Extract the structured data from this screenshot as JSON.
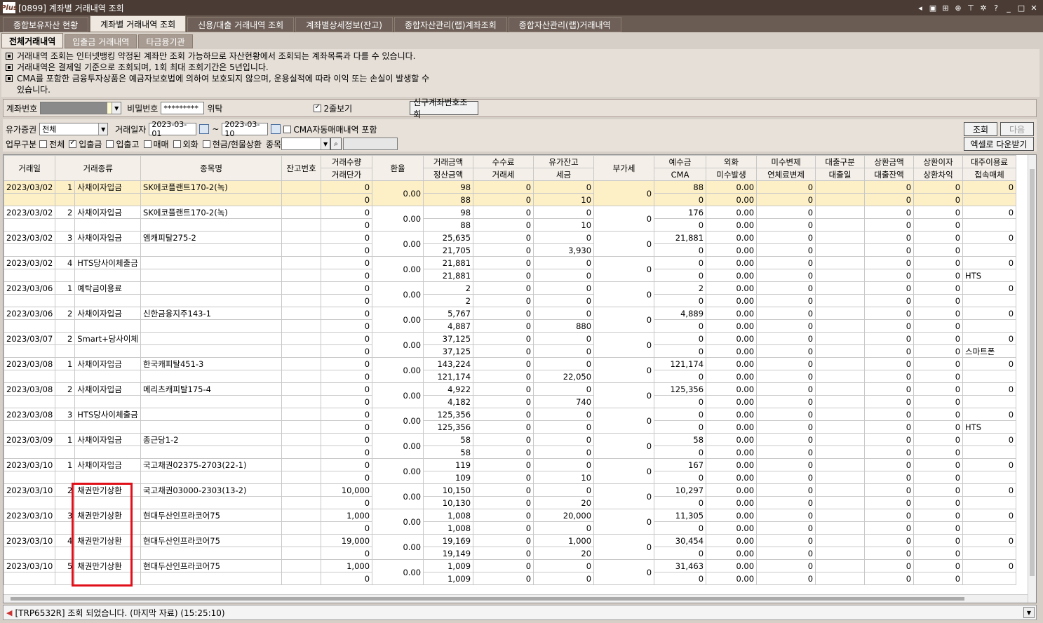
{
  "window": {
    "title": "[0899] 계좌별 거래내역 조회",
    "logo": "Plus"
  },
  "main_tabs": [
    "종합보유자산 현황",
    "계좌별 거래내역 조회",
    "신용/대출 거래내역 조회",
    "계좌별상세정보(잔고)",
    "종합자산관리(랩)계좌조회",
    "종합자산관리(랩)거래내역"
  ],
  "sub_tabs": [
    "전체거래내역",
    "입출금 거래내역",
    "타금융기관"
  ],
  "notices": [
    "거래내역 조회는 인터넷뱅킹 약정된 계좌만 조회 가능하므로 자산현황에서 조회되는 계좌목록과 다를 수 있습니다.",
    "거래내역은 결제일 기준으로 조회되며, 1회 최대 조회기간은 5년입니다.",
    "CMA를 포함한 금융투자상품은 예금자보호법에 의하여 보호되지 않으며, 운용실적에 따라 이익 또는 손실이 발생할 수",
    "있습니다."
  ],
  "account": {
    "account_label": "계좌번호",
    "password_label": "비밀번호",
    "password_value": "*********",
    "trust_label": "위탁",
    "two_line_label": "2줄보기",
    "new_account_button": "신구계좌번호조회"
  },
  "filter": {
    "securities_label": "유가증권",
    "securities_value": "전체",
    "date_label": "거래일자",
    "date_from": "2023-03-01",
    "date_sep": "~",
    "date_to": "2023-03-10",
    "cma_label": "CMA자동매매내역 포함",
    "business_label": "업무구분",
    "opts": [
      "전체",
      "입출금",
      "입출고",
      "매매",
      "외화",
      "현금/현물상환"
    ],
    "item_label": "종목",
    "search_button": "조회",
    "next_button": "다음",
    "excel_button": "엑셀로 다운받기"
  },
  "columns_top": [
    "거래일",
    "거래종류",
    "종목명",
    "잔고번호",
    "거래수량",
    "환율",
    "거래금액",
    "수수료",
    "유가잔고",
    "부가세",
    "예수금",
    "외화",
    "미수변제",
    "대출구분",
    "상환금액",
    "상환이자",
    "대주이용료"
  ],
  "columns_bottom": [
    "거래단가",
    "정산금액",
    "거래세",
    "세금",
    "CMA",
    "미수발생",
    "연체료변제",
    "대출일",
    "대출잔액",
    "상환차익",
    "접속매체"
  ],
  "rows": [
    {
      "date": "2023/03/02",
      "no": "1",
      "type": "사채이자입금",
      "name": "SK에코플랜트170-2(녹)",
      "qty": "0",
      "price": "0",
      "rate": "0.00",
      "amt": "98",
      "settle": "88",
      "fee": "0",
      "tax": "0",
      "bal": "0",
      "bal_tax": "10",
      "vat": "0",
      "dep": "88",
      "cma": "0",
      "fx": "0.00",
      "fx2": "0.00",
      "mis": "0",
      "mis2": "0",
      "rep": "0",
      "rep2": "0",
      "int": "0",
      "int2": "0",
      "use": "0",
      "media": "",
      "sel": true
    },
    {
      "date": "2023/03/02",
      "no": "2",
      "type": "사채이자입금",
      "name": "SK에코플랜트170-2(녹)",
      "qty": "0",
      "price": "0",
      "rate": "0.00",
      "amt": "98",
      "settle": "88",
      "fee": "0",
      "tax": "0",
      "bal": "0",
      "bal_tax": "10",
      "vat": "0",
      "dep": "176",
      "cma": "0",
      "fx": "0.00",
      "fx2": "0.00",
      "mis": "0",
      "mis2": "0",
      "rep": "0",
      "rep2": "0",
      "int": "0",
      "int2": "0",
      "use": "0",
      "media": ""
    },
    {
      "date": "2023/03/02",
      "no": "3",
      "type": "사채이자입금",
      "name": "엠캐피탈275-2",
      "qty": "0",
      "price": "0",
      "rate": "0.00",
      "amt": "25,635",
      "settle": "21,705",
      "fee": "0",
      "tax": "0",
      "bal": "0",
      "bal_tax": "3,930",
      "vat": "0",
      "dep": "21,881",
      "cma": "0",
      "fx": "0.00",
      "fx2": "0.00",
      "mis": "0",
      "mis2": "0",
      "rep": "0",
      "rep2": "0",
      "int": "0",
      "int2": "0",
      "use": "0",
      "media": ""
    },
    {
      "date": "2023/03/02",
      "no": "4",
      "type": "HTS당사이체출금",
      "name": "",
      "qty": "0",
      "price": "0",
      "rate": "0.00",
      "amt": "21,881",
      "settle": "21,881",
      "fee": "0",
      "tax": "0",
      "bal": "0",
      "bal_tax": "0",
      "vat": "0",
      "dep": "0",
      "cma": "0",
      "fx": "0.00",
      "fx2": "0.00",
      "mis": "0",
      "mis2": "0",
      "rep": "0",
      "rep2": "0",
      "int": "0",
      "int2": "0",
      "use": "0",
      "media": "HTS"
    },
    {
      "date": "2023/03/06",
      "no": "1",
      "type": "예탁금이용료",
      "name": "",
      "qty": "0",
      "price": "0",
      "rate": "0.00",
      "amt": "2",
      "settle": "2",
      "fee": "0",
      "tax": "0",
      "bal": "0",
      "bal_tax": "0",
      "vat": "0",
      "dep": "2",
      "cma": "0",
      "fx": "0.00",
      "fx2": "0.00",
      "mis": "0",
      "mis2": "0",
      "rep": "0",
      "rep2": "0",
      "int": "0",
      "int2": "0",
      "use": "0",
      "media": ""
    },
    {
      "date": "2023/03/06",
      "no": "2",
      "type": "사채이자입금",
      "name": "신한금융지주143-1",
      "qty": "0",
      "price": "0",
      "rate": "0.00",
      "amt": "5,767",
      "settle": "4,887",
      "fee": "0",
      "tax": "0",
      "bal": "0",
      "bal_tax": "880",
      "vat": "0",
      "dep": "4,889",
      "cma": "0",
      "fx": "0.00",
      "fx2": "0.00",
      "mis": "0",
      "mis2": "0",
      "rep": "0",
      "rep2": "0",
      "int": "0",
      "int2": "0",
      "use": "0",
      "media": ""
    },
    {
      "date": "2023/03/07",
      "no": "2",
      "type": "Smart+당사이체",
      "name": "",
      "qty": "0",
      "price": "0",
      "rate": "0.00",
      "amt": "37,125",
      "settle": "37,125",
      "fee": "0",
      "tax": "0",
      "bal": "0",
      "bal_tax": "0",
      "vat": "0",
      "dep": "0",
      "cma": "0",
      "fx": "0.00",
      "fx2": "0.00",
      "mis": "0",
      "mis2": "0",
      "rep": "0",
      "rep2": "0",
      "int": "0",
      "int2": "0",
      "use": "0",
      "media": "스마트폰"
    },
    {
      "date": "2023/03/08",
      "no": "1",
      "type": "사채이자입금",
      "name": "한국캐피탈451-3",
      "qty": "0",
      "price": "0",
      "rate": "0.00",
      "amt": "143,224",
      "settle": "121,174",
      "fee": "0",
      "tax": "0",
      "bal": "0",
      "bal_tax": "22,050",
      "vat": "0",
      "dep": "121,174",
      "cma": "0",
      "fx": "0.00",
      "fx2": "0.00",
      "mis": "0",
      "mis2": "0",
      "rep": "0",
      "rep2": "0",
      "int": "0",
      "int2": "0",
      "use": "0",
      "media": ""
    },
    {
      "date": "2023/03/08",
      "no": "2",
      "type": "사채이자입금",
      "name": "메리츠캐피탈175-4",
      "qty": "0",
      "price": "0",
      "rate": "0.00",
      "amt": "4,922",
      "settle": "4,182",
      "fee": "0",
      "tax": "0",
      "bal": "0",
      "bal_tax": "740",
      "vat": "0",
      "dep": "125,356",
      "cma": "0",
      "fx": "0.00",
      "fx2": "0.00",
      "mis": "0",
      "mis2": "0",
      "rep": "0",
      "rep2": "0",
      "int": "0",
      "int2": "0",
      "use": "0",
      "media": ""
    },
    {
      "date": "2023/03/08",
      "no": "3",
      "type": "HTS당사이체출금",
      "name": "",
      "qty": "0",
      "price": "0",
      "rate": "0.00",
      "amt": "125,356",
      "settle": "125,356",
      "fee": "0",
      "tax": "0",
      "bal": "0",
      "bal_tax": "0",
      "vat": "0",
      "dep": "0",
      "cma": "0",
      "fx": "0.00",
      "fx2": "0.00",
      "mis": "0",
      "mis2": "0",
      "rep": "0",
      "rep2": "0",
      "int": "0",
      "int2": "0",
      "use": "0",
      "media": "HTS"
    },
    {
      "date": "2023/03/09",
      "no": "1",
      "type": "사채이자입금",
      "name": "종근당1-2",
      "qty": "0",
      "price": "0",
      "rate": "0.00",
      "amt": "58",
      "settle": "58",
      "fee": "0",
      "tax": "0",
      "bal": "0",
      "bal_tax": "0",
      "vat": "0",
      "dep": "58",
      "cma": "0",
      "fx": "0.00",
      "fx2": "0.00",
      "mis": "0",
      "mis2": "0",
      "rep": "0",
      "rep2": "0",
      "int": "0",
      "int2": "0",
      "use": "0",
      "media": ""
    },
    {
      "date": "2023/03/10",
      "no": "1",
      "type": "사채이자입금",
      "name": "국고채권02375-2703(22-1)",
      "qty": "0",
      "price": "0",
      "rate": "0.00",
      "amt": "119",
      "settle": "109",
      "fee": "0",
      "tax": "0",
      "bal": "0",
      "bal_tax": "10",
      "vat": "0",
      "dep": "167",
      "cma": "0",
      "fx": "0.00",
      "fx2": "0.00",
      "mis": "0",
      "mis2": "0",
      "rep": "0",
      "rep2": "0",
      "int": "0",
      "int2": "0",
      "use": "0",
      "media": ""
    },
    {
      "date": "2023/03/10",
      "no": "2",
      "type": "채권만기상환",
      "name": "국고채권03000-2303(13-2)",
      "qty": "10,000",
      "price": "0",
      "rate": "0.00",
      "amt": "10,150",
      "settle": "10,130",
      "fee": "0",
      "tax": "0",
      "bal": "0",
      "bal_tax": "20",
      "vat": "0",
      "dep": "10,297",
      "cma": "0",
      "fx": "0.00",
      "fx2": "0.00",
      "mis": "0",
      "mis2": "0",
      "rep": "0",
      "rep2": "0",
      "int": "0",
      "int2": "0",
      "use": "0",
      "media": ""
    },
    {
      "date": "2023/03/10",
      "no": "3",
      "type": "채권만기상환",
      "name": "현대두산인프라코어75",
      "qty": "1,000",
      "price": "0",
      "rate": "0.00",
      "amt": "1,008",
      "settle": "1,008",
      "fee": "0",
      "tax": "0",
      "bal": "20,000",
      "bal_tax": "0",
      "vat": "0",
      "dep": "11,305",
      "cma": "0",
      "fx": "0.00",
      "fx2": "0.00",
      "mis": "0",
      "mis2": "0",
      "rep": "0",
      "rep2": "0",
      "int": "0",
      "int2": "0",
      "use": "0",
      "media": ""
    },
    {
      "date": "2023/03/10",
      "no": "4",
      "type": "채권만기상환",
      "name": "현대두산인프라코어75",
      "qty": "19,000",
      "price": "0",
      "rate": "0.00",
      "amt": "19,169",
      "settle": "19,149",
      "fee": "0",
      "tax": "0",
      "bal": "1,000",
      "bal_tax": "20",
      "vat": "0",
      "dep": "30,454",
      "cma": "0",
      "fx": "0.00",
      "fx2": "0.00",
      "mis": "0",
      "mis2": "0",
      "rep": "0",
      "rep2": "0",
      "int": "0",
      "int2": "0",
      "use": "0",
      "media": ""
    },
    {
      "date": "2023/03/10",
      "no": "5",
      "type": "채권만기상환",
      "name": "현대두산인프라코어75",
      "qty": "1,000",
      "price": "0",
      "rate": "0.00",
      "amt": "1,009",
      "settle": "1,009",
      "fee": "0",
      "tax": "0",
      "bal": "0",
      "bal_tax": "0",
      "vat": "0",
      "dep": "31,463",
      "cma": "0",
      "fx": "0.00",
      "fx2": "0.00",
      "mis": "0",
      "mis2": "0",
      "rep": "0",
      "rep2": "0",
      "int": "0",
      "int2": "0",
      "use": "0",
      "media": ""
    }
  ],
  "status": {
    "text": "[TRP6532R] 조회 되었습니다. (마지막 자료) (15:25:10)"
  },
  "highlight_color": "#e0101a"
}
